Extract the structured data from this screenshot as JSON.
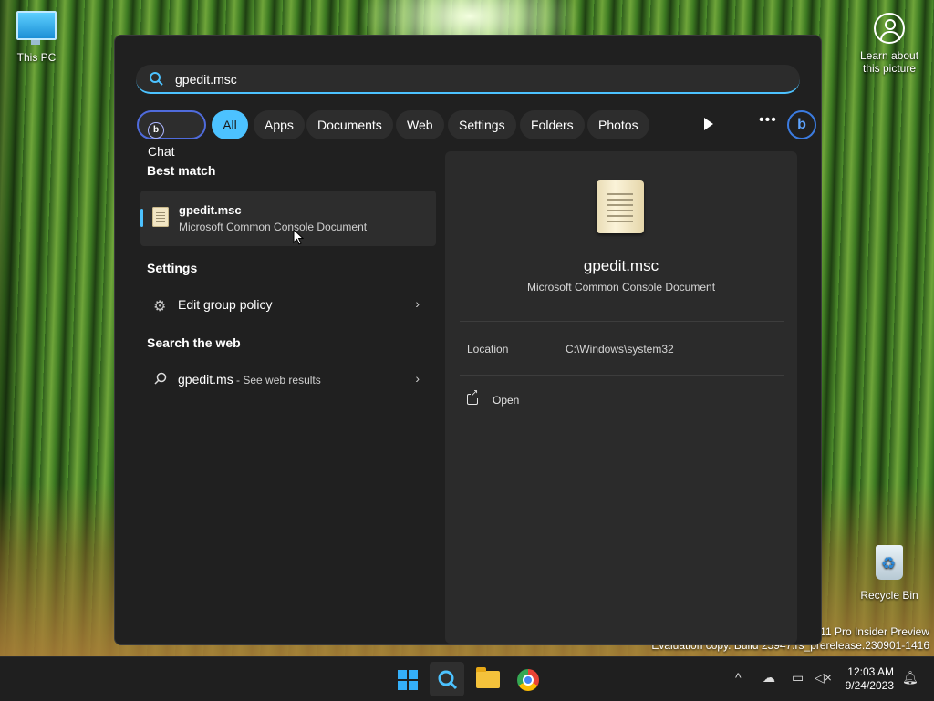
{
  "desktop": {
    "this_pc_label": "This PC",
    "recycle_bin_label": "Recycle Bin",
    "learn_line1": "Learn about",
    "learn_line2": "this picture",
    "watermark_line1": "s 11 Pro Insider Preview",
    "watermark_line2": "Evaluation copy. Build 25947.rs_prerelease.230901-1416"
  },
  "search": {
    "query": "gpedit.msc",
    "icon": "search-icon"
  },
  "filters": [
    {
      "label": "Chat"
    },
    {
      "label": "All"
    },
    {
      "label": "Apps"
    },
    {
      "label": "Documents"
    },
    {
      "label": "Web"
    },
    {
      "label": "Settings"
    },
    {
      "label": "Folders"
    },
    {
      "label": "Photos"
    }
  ],
  "results": {
    "best_match_header": "Best match",
    "best_match": {
      "name": "gpedit.msc",
      "type": "Microsoft Common Console Document"
    },
    "settings_header": "Settings",
    "settings_item": "Edit group policy",
    "web_header": "Search the web",
    "web_query": "gpedit.ms",
    "web_suffix": " - See web results"
  },
  "preview": {
    "title": "gpedit.msc",
    "subtitle": "Microsoft Common Console Document",
    "location_label": "Location",
    "location_value": "C:\\Windows\\system32",
    "open_label": "Open"
  },
  "taskbar": {
    "time": "12:03 AM",
    "date": "9/24/2023"
  },
  "colors": {
    "accent": "#4cc2ff",
    "panel_bg": "#202020",
    "preview_bg": "#2b2b2b",
    "taskbar_bg": "#1f1f1f"
  }
}
